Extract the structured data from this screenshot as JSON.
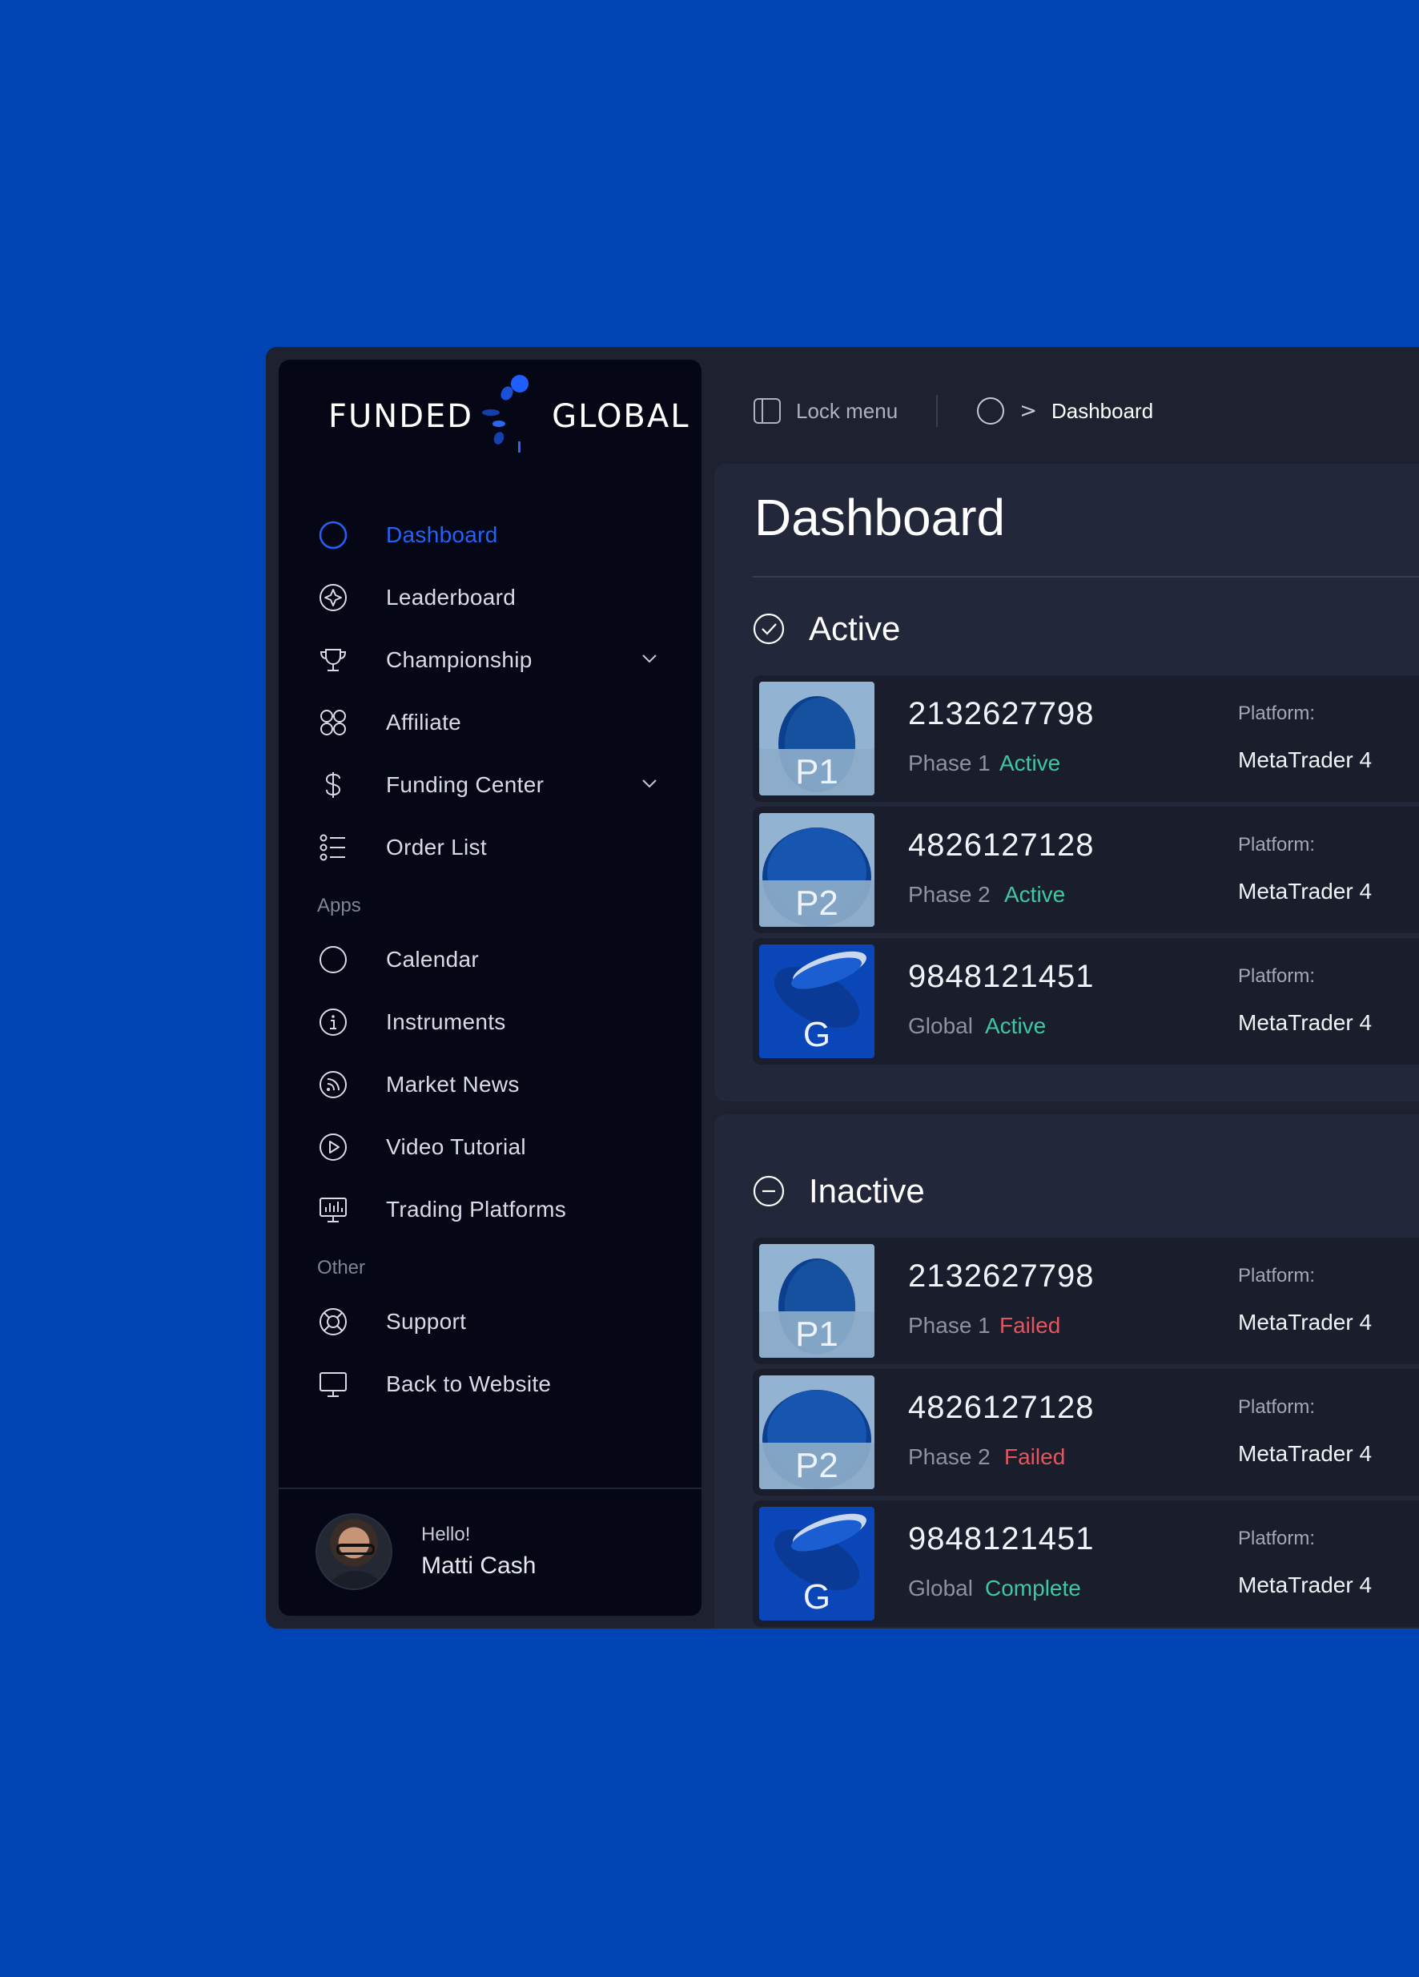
{
  "brand": {
    "left": "FUNDED",
    "right": "GLOBAL",
    "accent": "#1f5eff"
  },
  "nav": {
    "items": [
      {
        "label": "Dashboard",
        "icon": "circle-icon",
        "active": true
      },
      {
        "label": "Leaderboard",
        "icon": "star-badge-icon"
      },
      {
        "label": "Championship",
        "icon": "trophy-icon",
        "expandable": true
      },
      {
        "label": "Affiliate",
        "icon": "four-circles-icon"
      },
      {
        "label": "Funding Center",
        "icon": "dollar-icon",
        "expandable": true
      },
      {
        "label": "Order List",
        "icon": "list-icon"
      }
    ],
    "apps_heading": "Apps",
    "apps": [
      {
        "label": "Calendar",
        "icon": "circle-icon"
      },
      {
        "label": "Instruments",
        "icon": "info-icon"
      },
      {
        "label": "Market News",
        "icon": "rss-icon"
      },
      {
        "label": "Video Tutorial",
        "icon": "play-icon"
      },
      {
        "label": "Trading Platforms",
        "icon": "chart-monitor-icon"
      }
    ],
    "other_heading": "Other",
    "other": [
      {
        "label": "Support",
        "icon": "lifebuoy-icon"
      },
      {
        "label": "Back to Website",
        "icon": "monitor-icon"
      }
    ]
  },
  "user": {
    "greeting": "Hello!",
    "name": "Matti Cash"
  },
  "topbar": {
    "lock_label": "Lock menu",
    "breadcrumb_current": "Dashboard",
    "breadcrumb_separator": ">"
  },
  "page": {
    "title": "Dashboard"
  },
  "sections": {
    "active": {
      "label": "Active",
      "accounts": [
        {
          "badge": "P1",
          "number": "2132627798",
          "phase": "Phase 1",
          "status": "Active",
          "platform_label": "Platform:",
          "platform": "MetaTrader 4"
        },
        {
          "badge": "P2",
          "number": "4826127128",
          "phase": "Phase 2",
          "status": "Active",
          "platform_label": "Platform:",
          "platform": "MetaTrader 4"
        },
        {
          "badge": "G",
          "number": "9848121451",
          "phase": "Global",
          "status": "Active",
          "platform_label": "Platform:",
          "platform": "MetaTrader 4"
        }
      ]
    },
    "inactive": {
      "label": "Inactive",
      "accounts": [
        {
          "badge": "P1",
          "number": "2132627798",
          "phase": "Phase 1",
          "status": "Failed",
          "platform_label": "Platform:",
          "platform": "MetaTrader 4"
        },
        {
          "badge": "P2",
          "number": "4826127128",
          "phase": "Phase 2",
          "status": "Failed",
          "platform_label": "Platform:",
          "platform": "MetaTrader 4"
        },
        {
          "badge": "G",
          "number": "9848121451",
          "phase": "Global",
          "status": "Complete",
          "platform_label": "Platform:",
          "platform": "MetaTrader 4"
        }
      ]
    }
  },
  "colors": {
    "background": "#0043b5",
    "sidebar": "#050716",
    "panel": "#23273a",
    "active_nav": "#2462f5",
    "status_active": "#3fc7a3",
    "status_failed": "#e0575f",
    "status_complete": "#3fc7a3"
  }
}
